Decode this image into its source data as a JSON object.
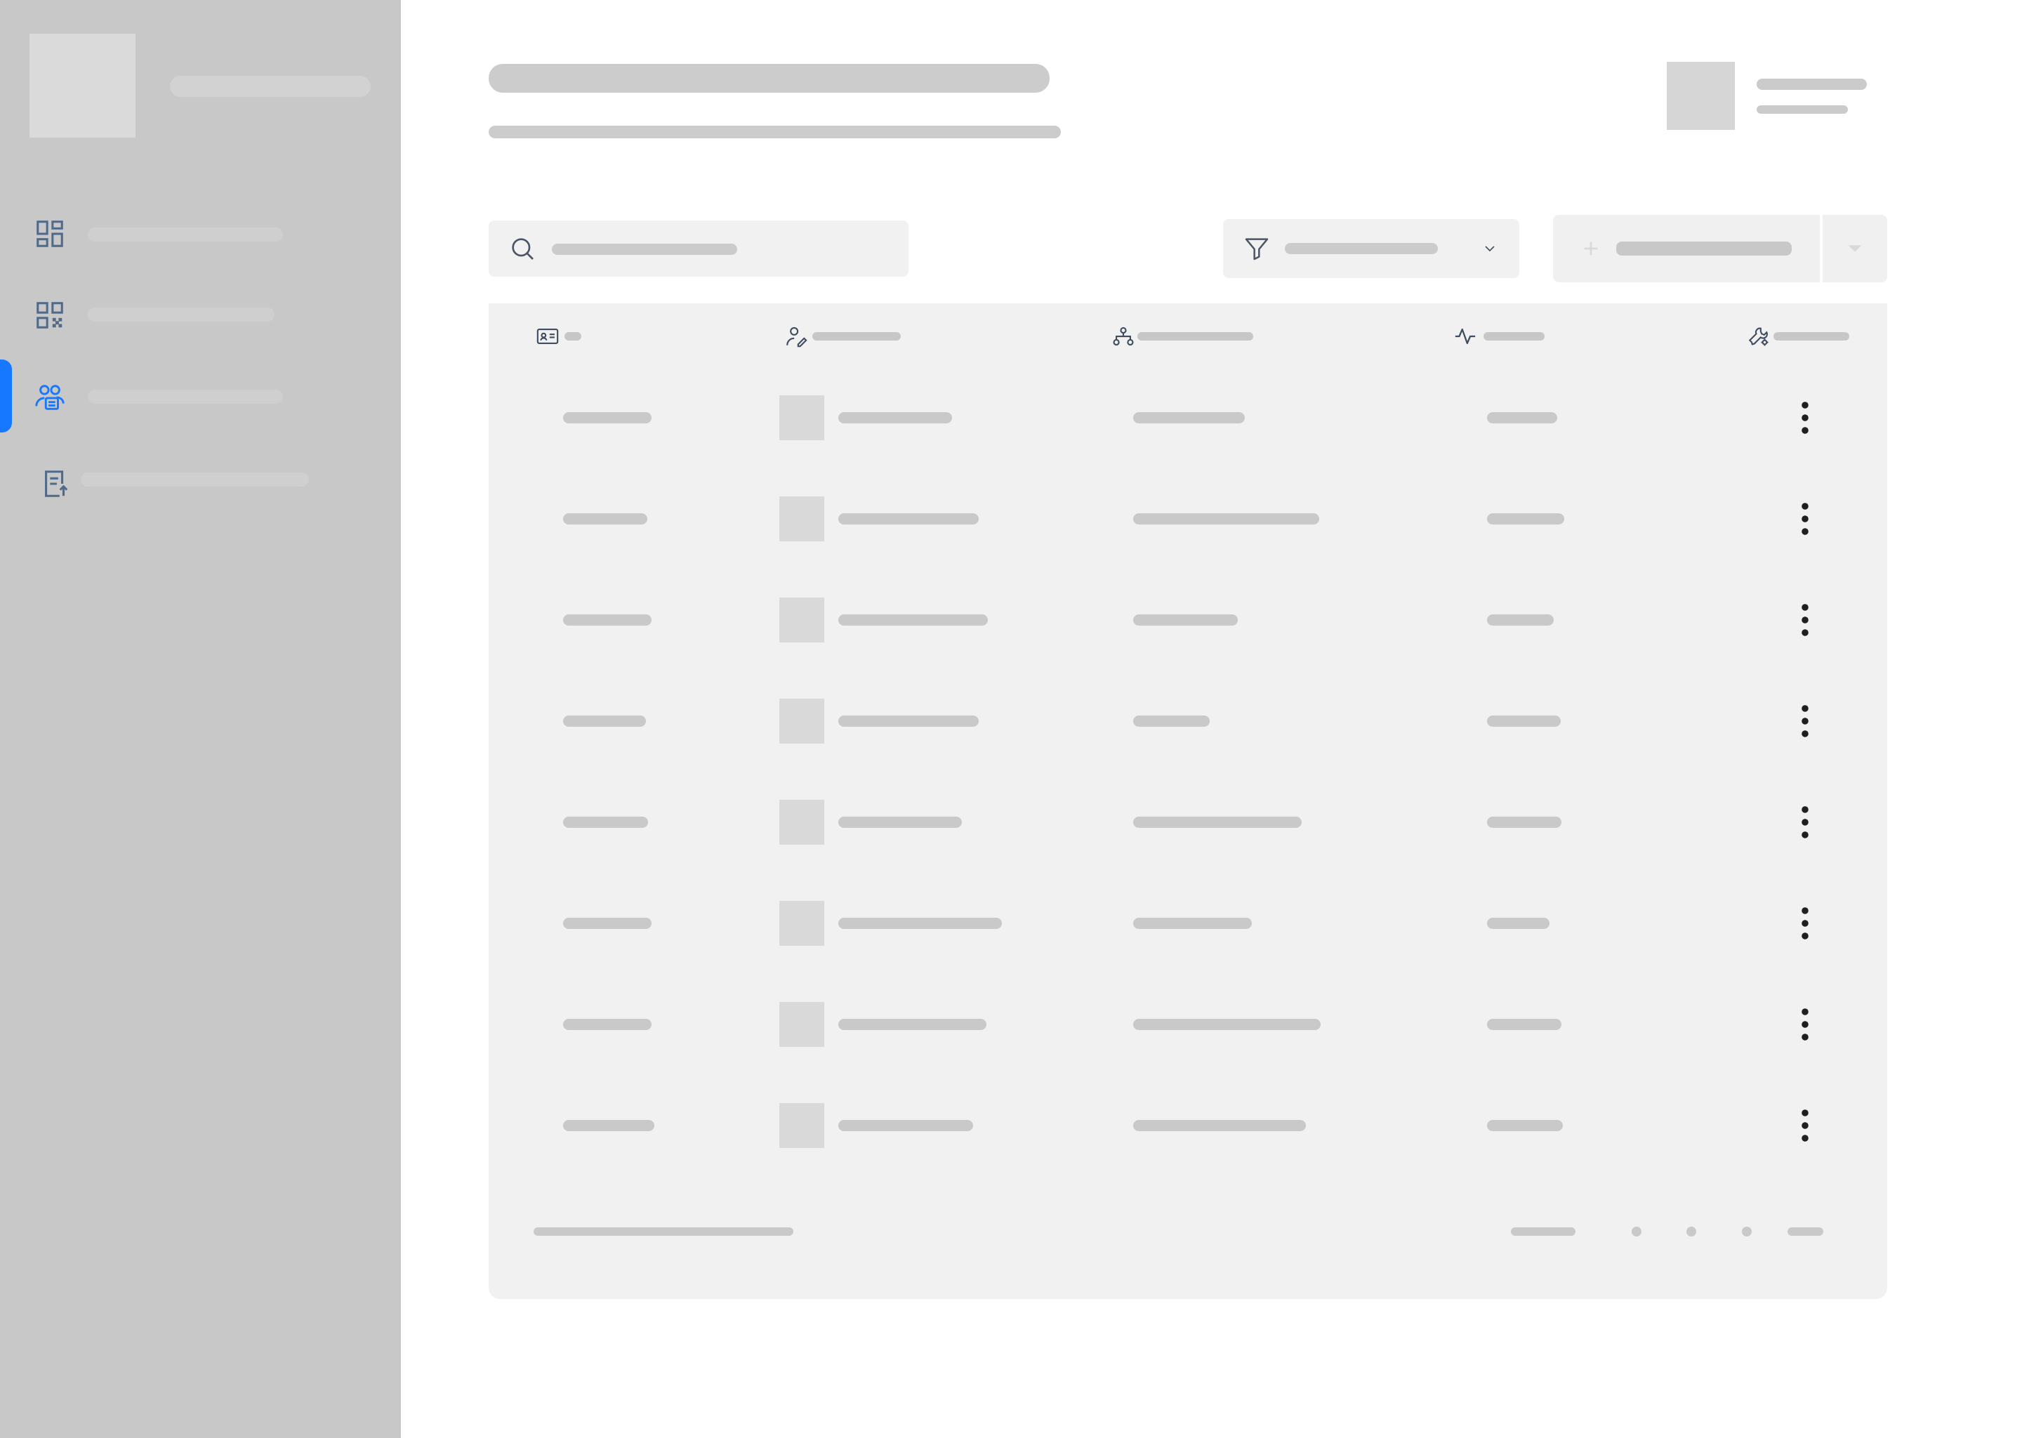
{
  "sidebar": {
    "logo": "app-logo",
    "app_title": "",
    "items": [
      {
        "id": "dashboard",
        "icon": "dashboard-icon",
        "label": "",
        "active": false
      },
      {
        "id": "qr",
        "icon": "qr-code-icon",
        "label": "",
        "active": false
      },
      {
        "id": "users",
        "icon": "user-group-icon",
        "label": "",
        "active": true
      },
      {
        "id": "reports",
        "icon": "document-upload-icon",
        "label": "",
        "active": false
      }
    ],
    "accent_color": "#1677ff"
  },
  "header": {
    "title": "",
    "subtitle": "",
    "user": {
      "avatar": "avatar",
      "name": "",
      "role": ""
    }
  },
  "toolbar": {
    "search": {
      "icon": "search-icon",
      "placeholder": ""
    },
    "filter": {
      "icon": "filter-icon",
      "value": "",
      "chevron": "chevron-down-icon"
    },
    "add_button": {
      "icon": "plus-icon",
      "label": "",
      "dropdown_icon": "caret-down-icon"
    }
  },
  "table": {
    "columns": [
      {
        "icon": "id-card-icon",
        "label": ""
      },
      {
        "icon": "user-edit-icon",
        "label": ""
      },
      {
        "icon": "hierarchy-icon",
        "label": ""
      },
      {
        "icon": "activity-icon",
        "label": ""
      },
      {
        "icon": "settings-tool-icon",
        "label": ""
      }
    ],
    "rows": [
      {
        "id": "",
        "name": "",
        "group": "",
        "status": "",
        "action_icon": "more-vertical-icon"
      },
      {
        "id": "",
        "name": "",
        "group": "",
        "status": "",
        "action_icon": "more-vertical-icon"
      },
      {
        "id": "",
        "name": "",
        "group": "",
        "status": "",
        "action_icon": "more-vertical-icon"
      },
      {
        "id": "",
        "name": "",
        "group": "",
        "status": "",
        "action_icon": "more-vertical-icon"
      },
      {
        "id": "",
        "name": "",
        "group": "",
        "status": "",
        "action_icon": "more-vertical-icon"
      },
      {
        "id": "",
        "name": "",
        "group": "",
        "status": "",
        "action_icon": "more-vertical-icon"
      },
      {
        "id": "",
        "name": "",
        "group": "",
        "status": "",
        "action_icon": "more-vertical-icon"
      },
      {
        "id": "",
        "name": "",
        "group": "",
        "status": "",
        "action_icon": "more-vertical-icon"
      }
    ]
  },
  "pagination": {
    "info": "",
    "prev": "",
    "pages": [
      "",
      "",
      ""
    ],
    "next": ""
  }
}
